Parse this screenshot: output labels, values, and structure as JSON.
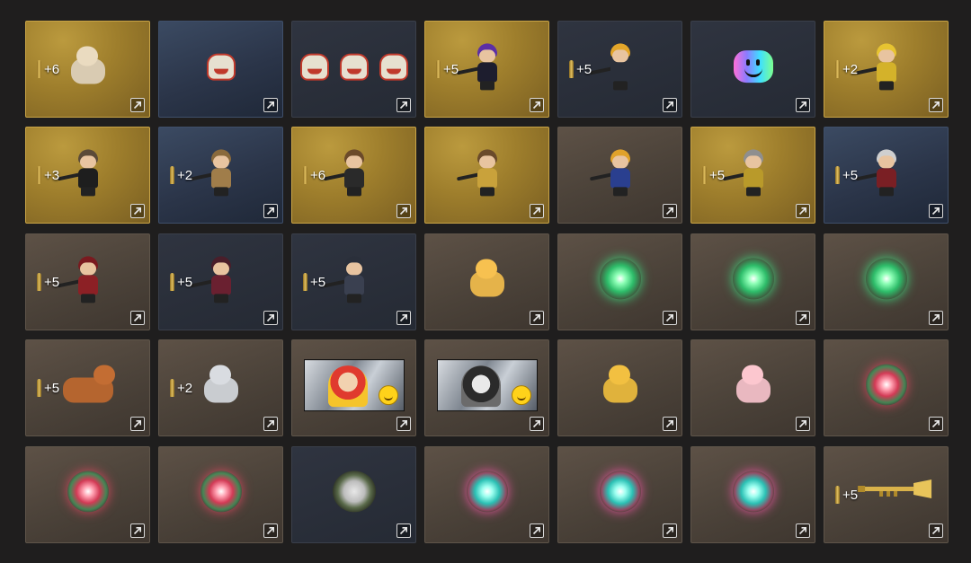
{
  "inventory": {
    "expand_icon": "expand-arrow-icon",
    "bonus_icon": "ammo-bullet-icon",
    "tiles": [
      {
        "bg": "gold",
        "bonus": "+6",
        "item": "lion-pet-icon"
      },
      {
        "bg": "blue",
        "bonus": "",
        "item": "lion-dance-icon"
      },
      {
        "bg": "dark",
        "bonus": "",
        "item": "lion-dance-set-icon"
      },
      {
        "bg": "gold",
        "bonus": "+5",
        "item": "purple-soldier-icon"
      },
      {
        "bg": "dark",
        "bonus": "+5",
        "item": "blonde-soldier-icon"
      },
      {
        "bg": "dark",
        "bonus": "",
        "item": "rainbow-smiley-badge-icon"
      },
      {
        "bg": "gold",
        "bonus": "+2",
        "item": "yellow-soldier-icon"
      },
      {
        "bg": "gold",
        "bonus": "+3",
        "item": "dark-soldier-icon"
      },
      {
        "bg": "blue",
        "bonus": "+2",
        "item": "desert-soldier-icon"
      },
      {
        "bg": "gold",
        "bonus": "+6",
        "item": "rifle-soldier-icon"
      },
      {
        "bg": "gold",
        "bonus": "",
        "item": "gold-armor-soldier-icon"
      },
      {
        "bg": "brown",
        "bonus": "",
        "item": "blue-sniper-soldier-icon"
      },
      {
        "bg": "gold",
        "bonus": "+5",
        "item": "veteran-soldier-icon"
      },
      {
        "bg": "blue",
        "bonus": "+5",
        "item": "red-soldier-icon"
      },
      {
        "bg": "brown",
        "bonus": "+5",
        "item": "crimson-soldier-icon"
      },
      {
        "bg": "dark",
        "bonus": "+5",
        "item": "maroon-soldier-icon"
      },
      {
        "bg": "dark",
        "bonus": "+5",
        "item": "swat-soldier-icon"
      },
      {
        "bg": "brown",
        "bonus": "",
        "item": "tiger-pet-icon"
      },
      {
        "bg": "brown",
        "bonus": "",
        "item": "green-orb-icon"
      },
      {
        "bg": "brown",
        "bonus": "",
        "item": "green-orb-icon"
      },
      {
        "bg": "brown",
        "bonus": "",
        "item": "green-orb-icon"
      },
      {
        "bg": "brown",
        "bonus": "+5",
        "item": "ox-pet-icon"
      },
      {
        "bg": "brown",
        "bonus": "+2",
        "item": "cat-pet-icon"
      },
      {
        "bg": "brown",
        "bonus": "",
        "item": "clown-banner-card-icon"
      },
      {
        "bg": "brown",
        "bonus": "",
        "item": "astronaut-banner-card-icon"
      },
      {
        "bg": "brown",
        "bonus": "",
        "item": "hamster-pet-icon"
      },
      {
        "bg": "brown",
        "bonus": "",
        "item": "pig-pet-icon"
      },
      {
        "bg": "brown",
        "bonus": "",
        "item": "red-green-orb-icon"
      },
      {
        "bg": "brown",
        "bonus": "",
        "item": "red-green-orb-icon"
      },
      {
        "bg": "brown",
        "bonus": "",
        "item": "red-green-orb-icon"
      },
      {
        "bg": "dark",
        "bonus": "",
        "item": "skull-emblem-icon"
      },
      {
        "bg": "brown",
        "bonus": "",
        "item": "teal-pink-orb-icon"
      },
      {
        "bg": "brown",
        "bonus": "",
        "item": "teal-pink-orb-icon"
      },
      {
        "bg": "brown",
        "bonus": "",
        "item": "teal-pink-orb-icon"
      },
      {
        "bg": "brown",
        "bonus": "+5",
        "item": "golden-trumpet-icon"
      }
    ]
  }
}
